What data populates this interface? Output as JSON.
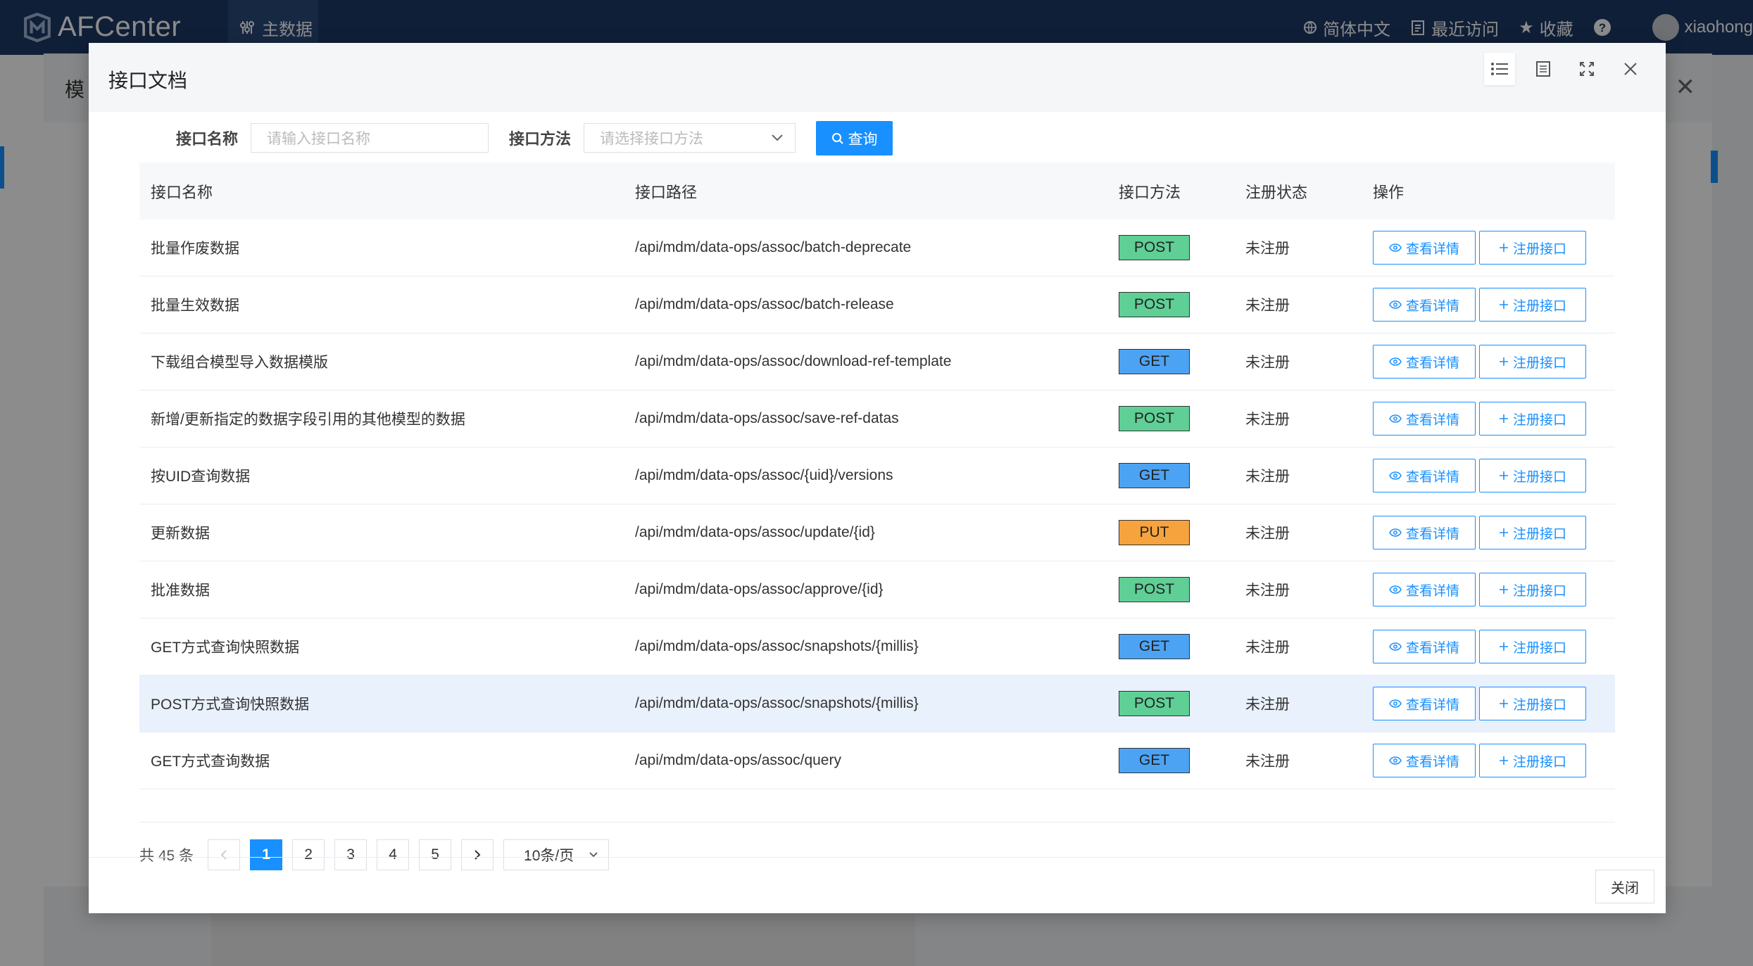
{
  "app": {
    "brand": "AFCenter",
    "nav_item": "主数据",
    "language": "简体中文",
    "recent": "最近访问",
    "favorites": "收藏",
    "username": "xiaohong"
  },
  "background_modal": {
    "title_fragment": "模"
  },
  "modal": {
    "title": "接口文档",
    "search": {
      "name_label": "接口名称",
      "name_placeholder": "请输入接口名称",
      "method_label": "接口方法",
      "method_placeholder": "请选择接口方法",
      "query_button": "查询"
    },
    "columns": [
      "接口名称",
      "接口路径",
      "接口方法",
      "注册状态",
      "操作"
    ],
    "rows": [
      {
        "name": "批量作废数据",
        "path": "/api/mdm/data-ops/assoc/batch-deprecate",
        "method": "POST",
        "status": "未注册",
        "view": "查看详情",
        "register": "注册接口"
      },
      {
        "name": "批量生效数据",
        "path": "/api/mdm/data-ops/assoc/batch-release",
        "method": "POST",
        "status": "未注册",
        "view": "查看详情",
        "register": "注册接口"
      },
      {
        "name": "下载组合模型导入数据模版",
        "path": "/api/mdm/data-ops/assoc/download-ref-template",
        "method": "GET",
        "status": "未注册",
        "view": "查看详情",
        "register": "注册接口"
      },
      {
        "name": "新增/更新指定的数据字段引用的其他模型的数据",
        "path": "/api/mdm/data-ops/assoc/save-ref-datas",
        "method": "POST",
        "status": "未注册",
        "view": "查看详情",
        "register": "注册接口"
      },
      {
        "name": "按UID查询数据",
        "path": "/api/mdm/data-ops/assoc/{uid}/versions",
        "method": "GET",
        "status": "未注册",
        "view": "查看详情",
        "register": "注册接口"
      },
      {
        "name": "更新数据",
        "path": "/api/mdm/data-ops/assoc/update/{id}",
        "method": "PUT",
        "status": "未注册",
        "view": "查看详情",
        "register": "注册接口"
      },
      {
        "name": "批准数据",
        "path": "/api/mdm/data-ops/assoc/approve/{id}",
        "method": "POST",
        "status": "未注册",
        "view": "查看详情",
        "register": "注册接口"
      },
      {
        "name": "GET方式查询快照数据",
        "path": "/api/mdm/data-ops/assoc/snapshots/{millis}",
        "method": "GET",
        "status": "未注册",
        "view": "查看详情",
        "register": "注册接口"
      },
      {
        "name": "POST方式查询快照数据",
        "path": "/api/mdm/data-ops/assoc/snapshots/{millis}",
        "method": "POST",
        "status": "未注册",
        "view": "查看详情",
        "register": "注册接口"
      },
      {
        "name": "GET方式查询数据",
        "path": "/api/mdm/data-ops/assoc/query",
        "method": "GET",
        "status": "未注册",
        "view": "查看详情",
        "register": "注册接口"
      }
    ],
    "highlighted_row": 8,
    "pagination": {
      "total": "共 45 条",
      "pages": [
        "1",
        "2",
        "3",
        "4",
        "5"
      ],
      "current": "1",
      "page_size": "10条/页"
    },
    "close_button": "关闭"
  },
  "colors": {
    "primary": "#1890ff",
    "post": "#5fcf96",
    "get": "#4da3f3",
    "put": "#f7a33d",
    "topbar": "#1e3a66"
  }
}
